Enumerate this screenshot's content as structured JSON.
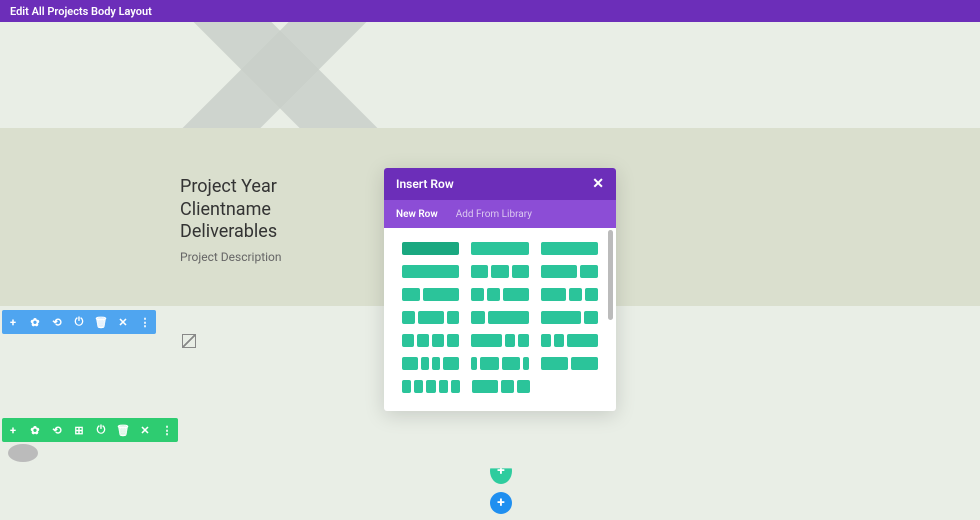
{
  "topbar": {
    "title": "Edit All Projects Body Layout"
  },
  "section1": {
    "line1": "Project Year",
    "line2": "Clientname",
    "line3": "Deliverables",
    "sub": "Project Description"
  },
  "toolbar": {
    "icons": [
      "+",
      "✿",
      "⟲",
      "⊞",
      "⏻",
      "✕",
      "⋮"
    ],
    "green_icons": [
      "+",
      "✿",
      "⟲",
      "⊞",
      "⏻",
      "🗑",
      "✕",
      "⋮"
    ]
  },
  "modal": {
    "title": "Insert Row",
    "tabs": {
      "new": "New Row",
      "lib": "Add From Library"
    },
    "layouts": [
      [
        [
          1
        ],
        [
          2
        ],
        [
          3
        ]
      ],
      [
        [
          4
        ],
        [
          1,
          1,
          1
        ],
        [
          2,
          1
        ]
      ],
      [
        [
          1,
          2
        ],
        [
          1,
          1,
          2
        ],
        [
          2,
          1,
          1
        ]
      ],
      [
        [
          1,
          2,
          1
        ],
        [
          1,
          3
        ],
        [
          3,
          1
        ]
      ],
      [
        [
          1,
          1,
          1,
          1
        ],
        [
          3,
          1,
          1
        ],
        [
          1,
          1,
          3
        ]
      ],
      [
        [
          2,
          1,
          1,
          2
        ],
        [
          1,
          3,
          3,
          1
        ],
        [
          1,
          1
        ]
      ],
      [
        [
          1,
          1,
          1,
          1,
          1
        ],
        [
          2,
          1,
          1
        ]
      ]
    ]
  },
  "add": {
    "plus": "+"
  }
}
